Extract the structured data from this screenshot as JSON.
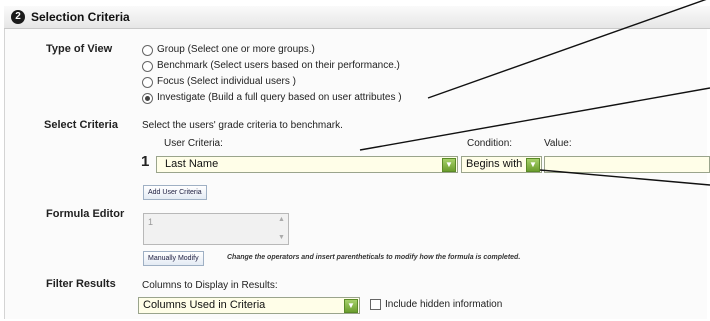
{
  "section": {
    "step": "2",
    "title": "Selection Criteria"
  },
  "type_of_view": {
    "label": "Type of View",
    "options": [
      {
        "text": "Group (Select one or more groups.)",
        "checked": false
      },
      {
        "text": "Benchmark (Select users based on their performance.)",
        "checked": false
      },
      {
        "text": "Focus (Select individual users )",
        "checked": false
      },
      {
        "text": "Investigate (Build a full query based on user attributes )",
        "checked": true
      }
    ]
  },
  "select_criteria": {
    "label": "Select Criteria",
    "instruction": "Select the users' grade criteria to benchmark.",
    "col_user_criteria": "User Criteria:",
    "col_condition": "Condition:",
    "col_value": "Value:",
    "row_number": "1",
    "user_criteria_value": "Last Name",
    "condition_value": "Begins with",
    "value_value": "",
    "add_button": "Add User Criteria"
  },
  "formula_editor": {
    "label": "Formula Editor",
    "value": "1",
    "modify_button": "Manually Modify",
    "help": "Change the operators and insert parentheticals to modify how the formula is completed."
  },
  "filter_results": {
    "label": "Filter Results",
    "columns_label": "Columns to Display in Results:",
    "columns_value": "Columns Used in Criteria",
    "include_hidden_label": "Include hidden information"
  },
  "icons": {
    "dropdown": "chevron-down-icon",
    "scroll": "scroll-arrow-icon"
  },
  "colors": {
    "select_bg": "#fffee8",
    "dropdown_btn": "#7aab38"
  }
}
